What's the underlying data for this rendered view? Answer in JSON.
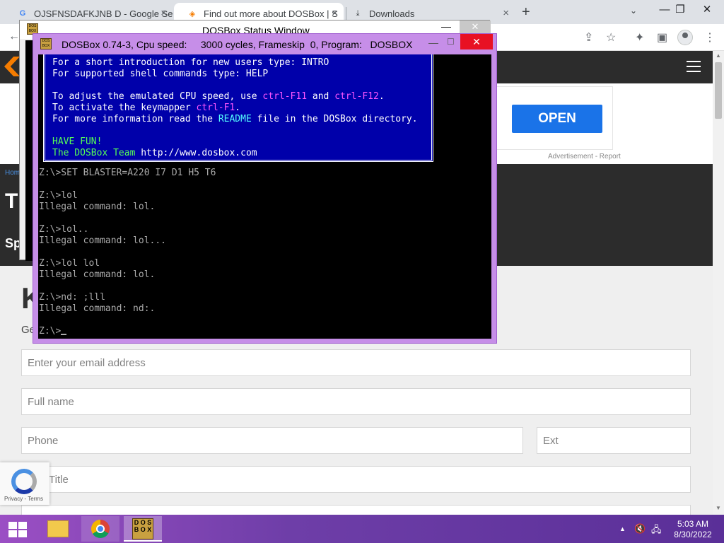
{
  "browser": {
    "tabs": [
      {
        "title": "OJSFNSDAFKJNB D - Google Sea",
        "icon": "google-g-icon"
      },
      {
        "title": "Find out more about DOSBox | S",
        "icon": "site-diamond-icon"
      },
      {
        "title": "Downloads",
        "icon": "download-icon"
      }
    ],
    "new_tab": "+",
    "tab_search": "⌄",
    "win_minimize": "—",
    "win_restore": "❐",
    "win_close": "✕",
    "toolbar": {
      "back": "←",
      "share": "⇪",
      "bookmark": "☆",
      "extensions": "✦",
      "sidepanel": "▣"
    }
  },
  "website": {
    "ad_button": "OPEN",
    "ad_label": "Advertisement - Report",
    "breadcrumb_home": "Hom",
    "hero_title": "T",
    "hero_subtitle": "Sp",
    "form_title": "K",
    "form_intro": "Ge",
    "fields": {
      "email": "Enter your email address",
      "full_name": "Full name",
      "phone": "Phone",
      "ext": "Ext",
      "title": "Title"
    },
    "recaptcha": "Privacy - Terms"
  },
  "status_window": {
    "title": "DOSBox Status Window",
    "icon_text": "DOS BOX",
    "minimize": "—",
    "maximize": "☐",
    "close": "✕"
  },
  "dosbox": {
    "title": "DOSBox 0.74-3, Cpu speed:     3000 cycles, Frameskip  0, Program:   DOSBOX",
    "icon_text": "DOS BOX",
    "minimize": "—",
    "maximize": "☐",
    "close": "✕",
    "banner": {
      "line1": "For a short introduction for new users type: INTRO",
      "line2": "For supported shell commands type: HELP",
      "line3a": "To adjust the emulated CPU speed, use ",
      "key1": "ctrl-F11",
      "line3b": " and ",
      "key2": "ctrl-F12",
      "line3c": ".",
      "line4a": "To activate the keymapper ",
      "key3": "ctrl-F1",
      "line4b": ".",
      "line5a": "For more information read the ",
      "readme": "README",
      "line5b": " file in the DOSBox directory.",
      "have_fun": "HAVE FUN!",
      "team": "The DOSBox Team",
      "url": " http://www.dosbox.com"
    },
    "console_lines": [
      "Z:\\>SET BLASTER=A220 I7 D1 H5 T6",
      "",
      "Z:\\>lol",
      "Illegal command: lol.",
      "",
      "Z:\\>lol..",
      "Illegal command: lol...",
      "",
      "Z:\\>lol lol",
      "Illegal command: lol.",
      "",
      "Z:\\>nd: ;lll",
      "Illegal command: nd:."
    ],
    "prompt": "Z:\\>"
  },
  "taskbar": {
    "dosbox_icon_text": "D O S B O X",
    "tray_chevron": "▲",
    "tray_volume": "🔇",
    "tray_network": "🖧",
    "time": "5:03 AM",
    "date": "8/30/2022"
  },
  "colors": {
    "dos_blue": "#0000aa",
    "dos_pink": "#ff55ff",
    "dos_green": "#55ff55",
    "dos_cyan": "#55ffff",
    "dos_title": "#c68ee8",
    "close_red": "#e81123",
    "taskbar": "#7a45b5",
    "ad_blue": "#1a73e8"
  }
}
